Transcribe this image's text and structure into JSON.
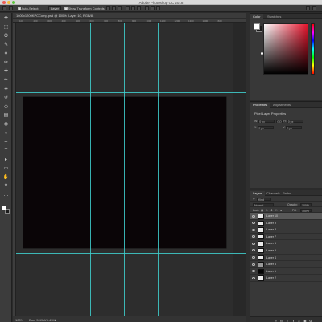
{
  "app": {
    "title": "Adobe Photoshop CC 2018"
  },
  "options_bar": {
    "auto_select_label": "Auto-Select:",
    "auto_select_value": "Layer",
    "transform_label": "Show Transform Controls"
  },
  "document": {
    "tab_title": "1600x1200KPCComp.psd @ 100% (Layer 10, RGB/8)"
  },
  "ruler": {
    "ticks": [
      "100",
      "200",
      "300",
      "400",
      "500",
      "600",
      "700",
      "800",
      "900",
      "1000",
      "1100",
      "1200",
      "1300",
      "1400",
      "1500"
    ]
  },
  "status": {
    "zoom": "100%",
    "doc": "Doc: 5.49M/5.49M"
  },
  "color_panel": {
    "tabs": [
      "Color",
      "Swatches"
    ],
    "foreground": "#ffffff",
    "background": "#1b1b1b"
  },
  "properties_panel": {
    "tabs": [
      "Properties",
      "Adjustments"
    ],
    "title": "Pixel Layer Properties",
    "w_label": "W:",
    "w_value": "0 px",
    "go_label": "GO",
    "h_label": "H:",
    "h_value": "0 px",
    "x_label": "X:",
    "x_value": "0 px",
    "y_label": "Y:",
    "y_value": "0 px"
  },
  "layers_panel": {
    "tabs": [
      "Layers",
      "Channels",
      "Paths"
    ],
    "filter_label": "Kind",
    "blend_mode": "Normal",
    "opacity_label": "Opacity:",
    "opacity_value": "100%",
    "lock_label": "Lock:",
    "fill_label": "Fill:",
    "fill_value": "100%",
    "layers": [
      {
        "name": "Layer 10",
        "selected": true,
        "thumb": "#e9e9e9"
      },
      {
        "name": "Layer 9",
        "selected": false,
        "thumb": "#e9e9e9"
      },
      {
        "name": "Layer 8",
        "selected": false,
        "thumb": "#e9e9e9"
      },
      {
        "name": "Layer 7",
        "selected": false,
        "thumb": "#e9e9e9"
      },
      {
        "name": "Layer 6",
        "selected": false,
        "thumb": "#e9e9e9"
      },
      {
        "name": "Layer 5",
        "selected": false,
        "thumb": "#e9e9e9"
      },
      {
        "name": "Layer 4",
        "selected": false,
        "thumb": "#e9e9e9"
      },
      {
        "name": "Layer 3",
        "selected": false,
        "thumb": "#9a9a9a"
      },
      {
        "name": "Layer 1",
        "selected": false,
        "thumb": "#050505"
      },
      {
        "name": "Layer 2",
        "selected": false,
        "thumb": "#e9e9e9"
      }
    ]
  },
  "tools": [
    "move-tool-icon",
    "marquee-tool-icon",
    "lasso-tool-icon",
    "quick-select-tool-icon",
    "crop-tool-icon",
    "eyedropper-tool-icon",
    "healing-tool-icon",
    "brush-tool-icon",
    "clone-stamp-tool-icon",
    "history-brush-tool-icon",
    "eraser-tool-icon",
    "gradient-tool-icon",
    "blur-tool-icon",
    "dodge-tool-icon",
    "pen-tool-icon",
    "type-tool-icon",
    "path-select-tool-icon",
    "shape-tool-icon",
    "hand-tool-icon",
    "zoom-tool-icon",
    "more-tools-icon"
  ],
  "colors": {
    "guide": "#3fd0cf",
    "artboard": "#0a0507",
    "ui_dark": "#2b2b2b"
  }
}
